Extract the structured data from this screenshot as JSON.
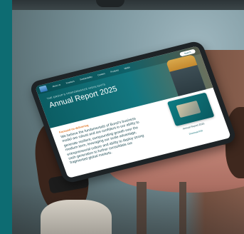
{
  "tablet_page": {
    "nav_items": [
      "About us",
      "Investors",
      "Sustainability",
      "Careers",
      "Products",
      "Media"
    ],
    "search_label": "Search",
    "kicker": "THE GROUP'S PERFORMANCE HIGHLIGHTS",
    "title": "Annual Report 2025",
    "section_label": "Focused on delivering",
    "body_text": "We believe the fundamentals of Bunzl's business model are robust and are confident in our ability to generate resilient, compounding growth over the medium term, leveraging our scale advantage, entrepreneurial culture and ability to deploy strong cash generation to further consolidate our fragmented global markets.",
    "report_caption": "Annual Report 2025",
    "report_link": "Download PDF"
  },
  "colors": {
    "sidebar": "#0d6c72",
    "hero": "#0b5d63",
    "accent": "#e07a2b"
  }
}
